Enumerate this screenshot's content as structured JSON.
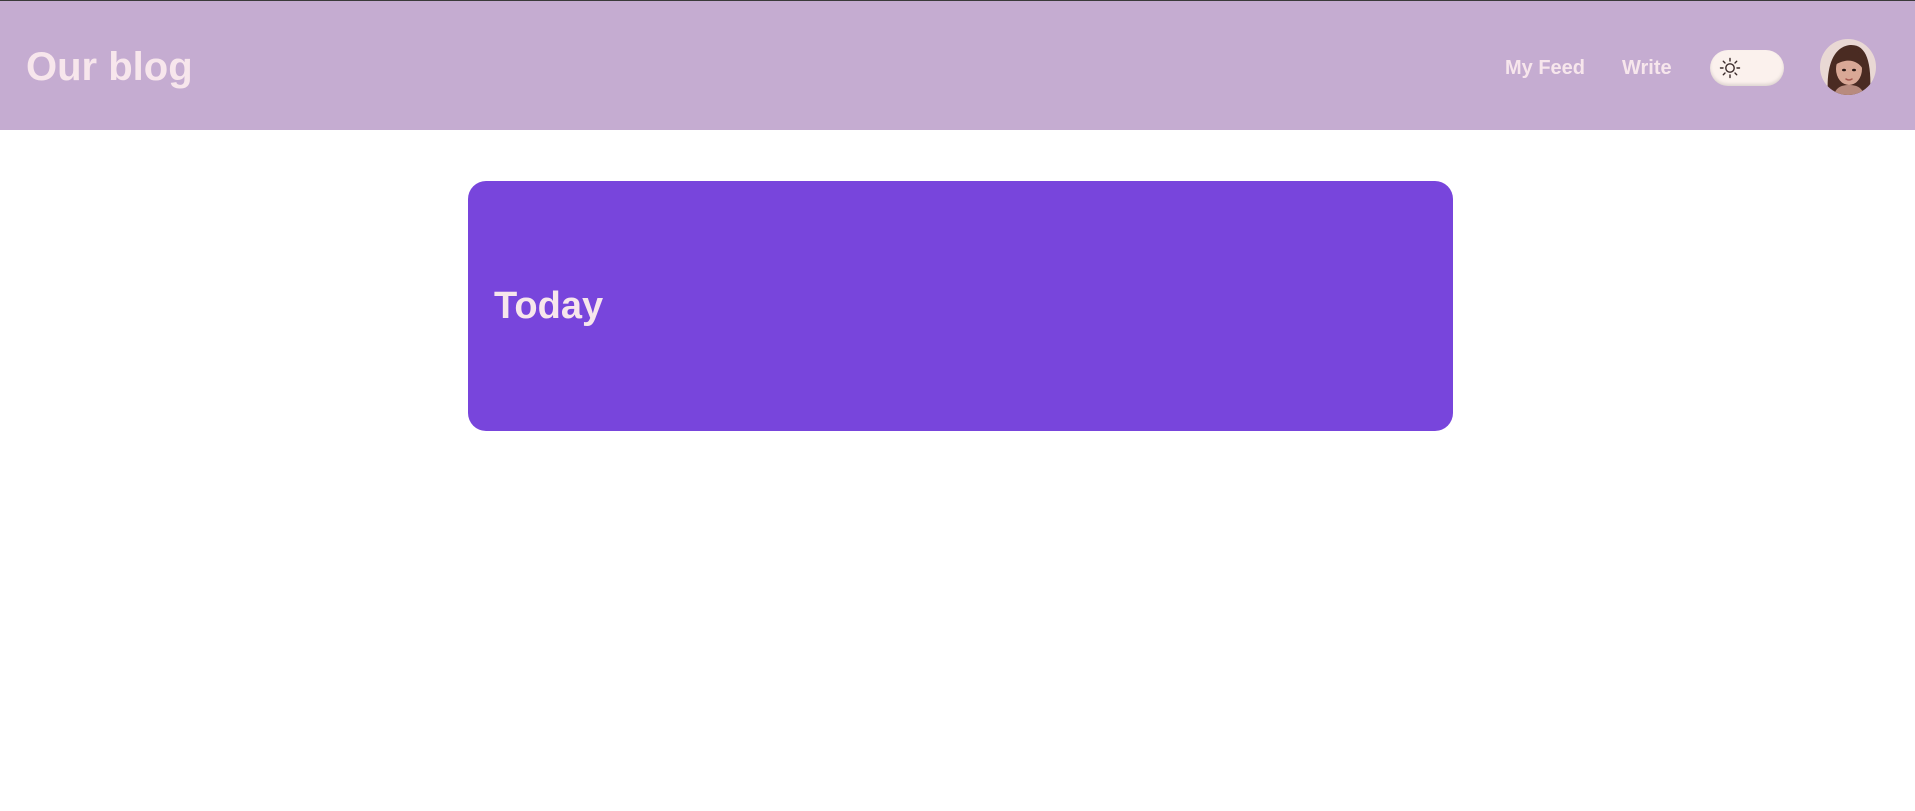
{
  "header": {
    "brand": "Our blog",
    "nav": [
      {
        "label": "My Feed"
      },
      {
        "label": "Write"
      }
    ],
    "theme_toggle": {
      "icon": "sun-icon",
      "state": "light"
    },
    "avatar": {
      "icon": "user-avatar"
    }
  },
  "main": {
    "card": {
      "title": "Today"
    }
  },
  "colors": {
    "header_bg": "#c5acd1",
    "header_text": "#f7e6ec",
    "card_bg": "#7845dc",
    "toggle_bg": "#fbf1ed"
  }
}
